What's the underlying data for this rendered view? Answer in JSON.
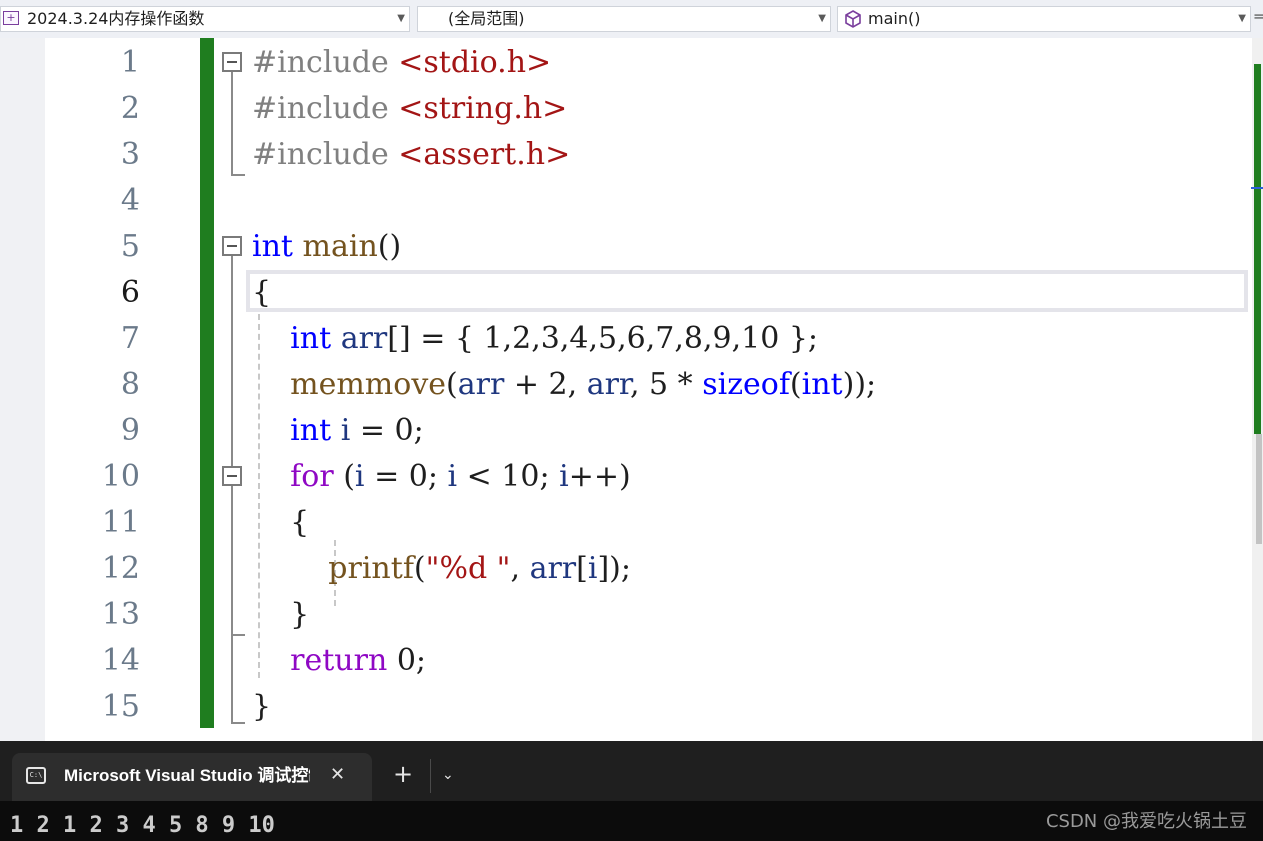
{
  "navbar": {
    "project": "2024.3.24内存操作函数",
    "scope": "(全局范围)",
    "member": "main()",
    "right_glyph": "="
  },
  "editor": {
    "current_line": 6,
    "line_numbers": [
      "1",
      "2",
      "3",
      "4",
      "5",
      "6",
      "7",
      "8",
      "9",
      "10",
      "11",
      "12",
      "13",
      "14",
      "15"
    ],
    "lines": [
      [
        {
          "t": "#include ",
          "c": "pp"
        },
        {
          "t": "<stdio.h>",
          "c": "inc"
        }
      ],
      [
        {
          "t": "#include ",
          "c": "pp"
        },
        {
          "t": "<string.h>",
          "c": "inc"
        }
      ],
      [
        {
          "t": "#include ",
          "c": "pp"
        },
        {
          "t": "<assert.h>",
          "c": "inc"
        }
      ],
      [],
      [
        {
          "t": "int",
          "c": "kw"
        },
        {
          "t": " "
        },
        {
          "t": "main",
          "c": "fn"
        },
        {
          "t": "()"
        }
      ],
      [
        {
          "t": "{"
        }
      ],
      [
        {
          "t": "    "
        },
        {
          "t": "int",
          "c": "kw"
        },
        {
          "t": " "
        },
        {
          "t": "arr",
          "c": "var"
        },
        {
          "t": "[] = { 1,2,3,4,5,6,7,8,9,10 };"
        }
      ],
      [
        {
          "t": "    "
        },
        {
          "t": "memmove",
          "c": "fn"
        },
        {
          "t": "("
        },
        {
          "t": "arr",
          "c": "var"
        },
        {
          "t": " + 2, "
        },
        {
          "t": "arr",
          "c": "var"
        },
        {
          "t": ", 5 * "
        },
        {
          "t": "sizeof",
          "c": "kw"
        },
        {
          "t": "("
        },
        {
          "t": "int",
          "c": "kw"
        },
        {
          "t": "));"
        }
      ],
      [
        {
          "t": "    "
        },
        {
          "t": "int",
          "c": "kw"
        },
        {
          "t": " "
        },
        {
          "t": "i",
          "c": "var"
        },
        {
          "t": " = 0;"
        }
      ],
      [
        {
          "t": "    "
        },
        {
          "t": "for",
          "c": "ctl"
        },
        {
          "t": " ("
        },
        {
          "t": "i",
          "c": "var"
        },
        {
          "t": " = 0; "
        },
        {
          "t": "i",
          "c": "var"
        },
        {
          "t": " < 10; "
        },
        {
          "t": "i",
          "c": "var"
        },
        {
          "t": "++)"
        }
      ],
      [
        {
          "t": "    {"
        }
      ],
      [
        {
          "t": "        "
        },
        {
          "t": "printf",
          "c": "fn"
        },
        {
          "t": "("
        },
        {
          "t": "\"%d \"",
          "c": "str"
        },
        {
          "t": ", "
        },
        {
          "t": "arr",
          "c": "var"
        },
        {
          "t": "["
        },
        {
          "t": "i",
          "c": "var"
        },
        {
          "t": "]);"
        }
      ],
      [
        {
          "t": "    }"
        }
      ],
      [
        {
          "t": "    "
        },
        {
          "t": "return",
          "c": "ctl"
        },
        {
          "t": " 0;"
        }
      ],
      [
        {
          "t": "}"
        }
      ]
    ]
  },
  "terminal": {
    "tab_icon_text": "C:\\",
    "tab_title": "Microsoft Visual Studio 调试控制台",
    "close_glyph": "✕",
    "add_glyph": "+",
    "dropdown_glyph": "⌄",
    "output": "1 2 1 2 3 4 5 8 9 10"
  },
  "watermark": "CSDN @我爱吃火锅土豆"
}
